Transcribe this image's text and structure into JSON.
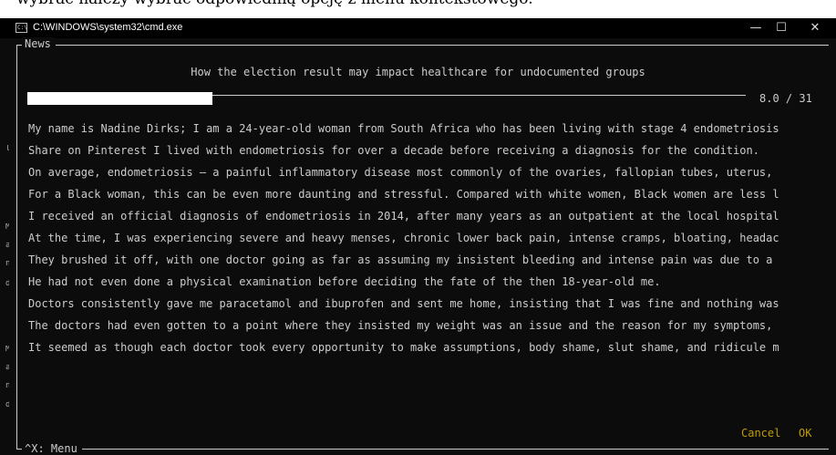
{
  "background_text": "wybrać należy wybrać odpowiednią opcję z menu kontekstowego.",
  "window": {
    "title": "C:\\WINDOWS\\system32\\cmd.exe",
    "app_icon_text": "C:\\",
    "controls": {
      "minimize": "—",
      "maximize": "☐",
      "close": "✕"
    }
  },
  "left_gutter_marks": [
    "l",
    "M",
    "a",
    "n",
    "d",
    "M",
    "a",
    "n",
    "d"
  ],
  "panel": {
    "label": "News",
    "heading": "How the election result may impact healthcare for undocumented groups",
    "progress": {
      "value": 8.0,
      "max": 31,
      "text": "8.0 / 31"
    },
    "lines": [
      "My name is Nadine Dirks; I am a 24-year-old woman from South Africa who has been living with stage 4 endometriosis",
      "Share on Pinterest I lived with endometriosis for over a decade before receiving a diagnosis for the condition.",
      "On average, endometriosis — a painful inflammatory disease most commonly of the ovaries, fallopian tubes, uterus,",
      "For a Black woman, this can be even more daunting and stressful. Compared with white women, Black women are less l",
      "I received an official diagnosis of endometriosis in 2014, after many years as an outpatient at the local hospital",
      "At the time, I was experiencing severe and heavy menses, chronic lower back pain, intense cramps, bloating, headac",
      "They brushed it off, with one doctor going as far as assuming my insistent bleeding and intense pain was due to a",
      "He had not even done a physical examination before deciding the fate of the then 18-year-old me.",
      "Doctors consistently gave me paracetamol and ibuprofen and sent me home, insisting that I was fine and nothing was",
      "The doctors had even gotten to a point where they insisted my weight was an issue and the reason for my symptoms,",
      "It seemed as though each doctor took every opportunity to make assumptions, body shame, slut shame, and ridicule m"
    ],
    "buttons": {
      "cancel": "Cancel",
      "ok": "OK"
    },
    "footer_label": "^X: Menu"
  },
  "colors": {
    "background": "#0c0c0c",
    "text": "#cccccc",
    "button": "#c19c00",
    "progress_fill": "#ffffff"
  }
}
